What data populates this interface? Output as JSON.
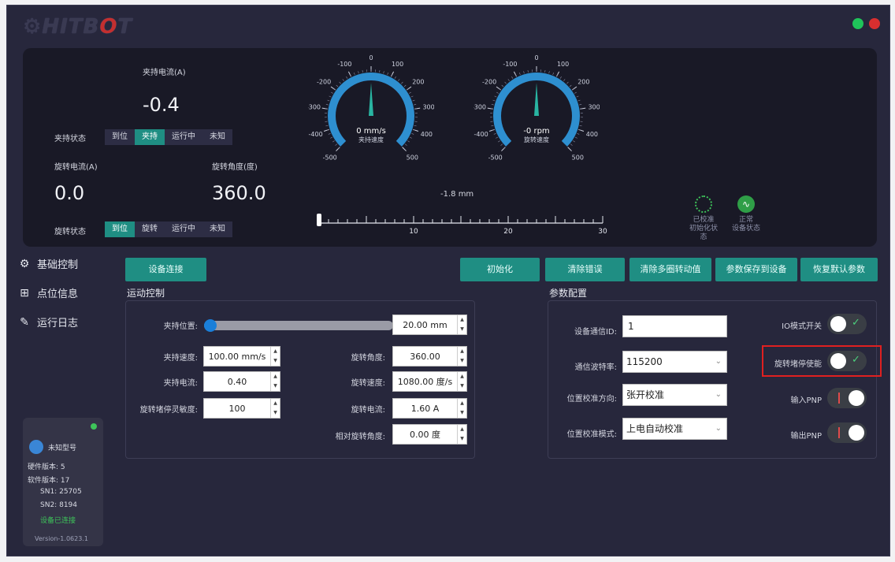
{
  "app": {
    "logo": "HITBOT",
    "win_colors": [
      "#1fc45a",
      "#d92f2f"
    ]
  },
  "top": {
    "clamp_current_label": "夹持电流(A)",
    "clamp_current_value": "-0.4",
    "clamp_state_label": "夹持状态",
    "clamp_states": [
      "到位",
      "夹持",
      "运行中",
      "未知"
    ],
    "clamp_state_active": 1,
    "rot_current_label": "旋转电流(A)",
    "rot_current_value": "0.0",
    "rot_angle_label": "旋转角度(度)",
    "rot_angle_value": "360.0",
    "rot_state_label": "旋转状态",
    "rot_states": [
      "到位",
      "旋转",
      "运行中",
      "未知"
    ],
    "rot_state_active": 0,
    "gauge1": {
      "value": "0 mm/s",
      "name": "夹持速度",
      "ticks": [
        "-500",
        "-400",
        "-300",
        "-200",
        "-100",
        "0",
        "100",
        "200",
        "300",
        "400",
        "500"
      ],
      "reading": 0
    },
    "gauge2": {
      "value": "-0 rpm",
      "name": "旋转速度",
      "ticks": [
        "-500",
        "-400",
        "-300",
        "-200",
        "-100",
        "0",
        "100",
        "200",
        "300",
        "400",
        "500"
      ],
      "reading": 0
    },
    "position_text": "-1.8 mm",
    "ruler_labels": [
      "10",
      "20",
      "30"
    ],
    "status_init": {
      "state": "已校准",
      "label": "初始化状态"
    },
    "status_dev": {
      "state": "正常",
      "label": "设备状态"
    }
  },
  "nav": [
    {
      "label": "基础控制",
      "icon": "gripper-icon"
    },
    {
      "label": "点位信息",
      "icon": "grid-icon"
    },
    {
      "label": "运行日志",
      "icon": "log-edit-icon"
    }
  ],
  "buttons": {
    "connect": "设备连接",
    "init": "初始化",
    "clear_error": "清除错误",
    "clear_multiturn": "清除多圈转动值",
    "save_params": "参数保存到设备",
    "restore_defaults": "恢复默认参数"
  },
  "motion": {
    "title": "运动控制",
    "clamp_position_label": "夹持位置:",
    "clamp_position_value": "20.00 mm",
    "clamp_position_fraction": 0.0,
    "clamp_speed_label": "夹持速度:",
    "clamp_speed_value": "100.00 mm/s",
    "clamp_current_label": "夹持电流:",
    "clamp_current_value": "0.40",
    "stall_sens_label": "旋转堵停灵敏度:",
    "stall_sens_value": "100",
    "rot_angle_label": "旋转角度:",
    "rot_angle_value": "360.00",
    "rot_speed_label": "旋转速度:",
    "rot_speed_value": "1080.00 度/s",
    "rot_current_label": "旋转电流:",
    "rot_current_value": "1.60 A",
    "rel_angle_label": "相对旋转角度:",
    "rel_angle_value": "0.00 度"
  },
  "params": {
    "title": "参数配置",
    "comm_id_label": "设备通信ID:",
    "comm_id_value": "1",
    "baud_label": "通信波特率:",
    "baud_value": "115200",
    "calib_dir_label": "位置校准方向:",
    "calib_dir_value": "张开校准",
    "calib_mode_label": "位置校准模式:",
    "calib_mode_value": "上电自动校准",
    "io_mode_label": "IO模式开关",
    "io_mode_on": false,
    "stall_enable_label": "旋转堵停使能",
    "stall_enable_on": false,
    "input_pnp_label": "输入PNP",
    "input_pnp_on": true,
    "output_pnp_label": "输出PNP",
    "output_pnp_on": true,
    "highlight_color": "#e02020"
  },
  "device": {
    "model": "未知型号",
    "hw_label": "硬件版本:",
    "hw_value": "5",
    "sw_label": "软件版本:",
    "sw_value": "17",
    "sn1_label": "SN1:",
    "sn1_value": "25705",
    "sn2_label": "SN2:",
    "sn2_value": "8194",
    "conn_status": "设备已连接",
    "version": "Version-1.0623.1"
  }
}
